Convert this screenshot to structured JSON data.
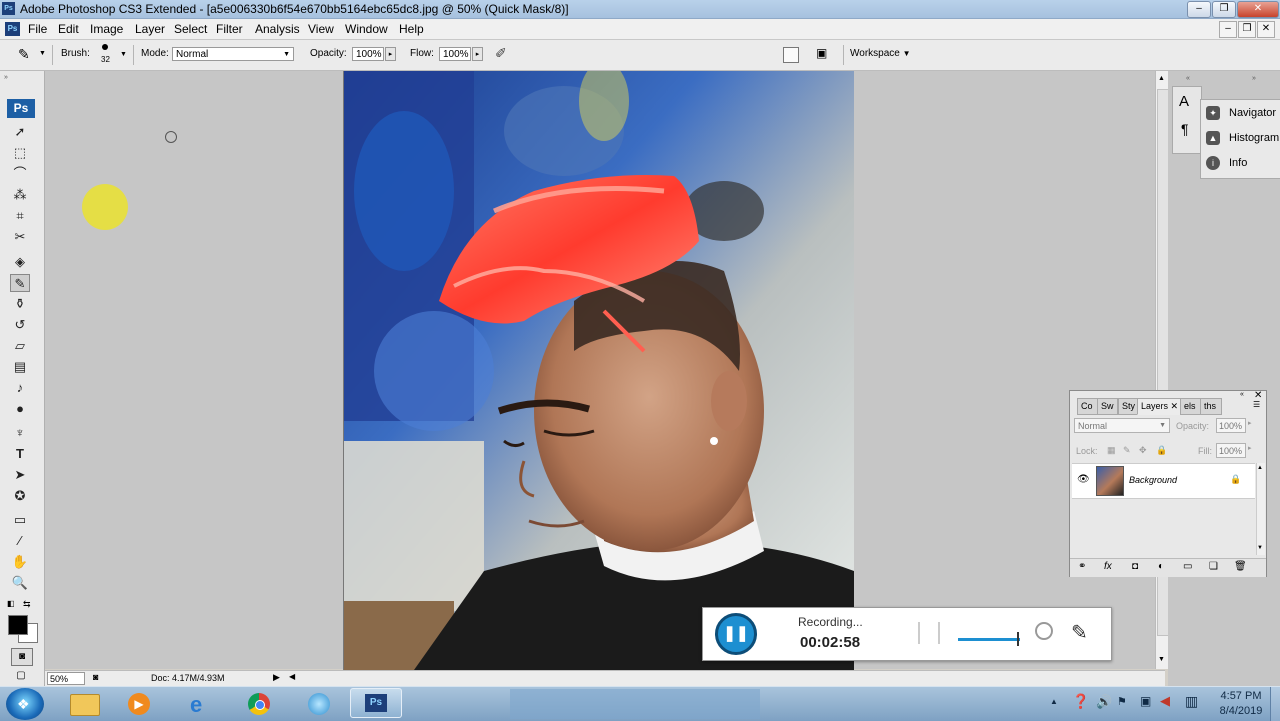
{
  "window": {
    "title": "Adobe Photoshop CS3 Extended - [a5e006330b6f54e670bb5164ebc65dc8.jpg @ 50% (Quick Mask/8)]"
  },
  "menu": [
    "File",
    "Edit",
    "Image",
    "Layer",
    "Select",
    "Filter",
    "Analysis",
    "View",
    "Window",
    "Help"
  ],
  "options": {
    "brush_label": "Brush:",
    "brush_size": "32",
    "mode_label": "Mode:",
    "mode_value": "Normal",
    "opacity_label": "Opacity:",
    "opacity_value": "100%",
    "flow_label": "Flow:",
    "flow_value": "100%",
    "workspace_label": "Workspace"
  },
  "toolbox": {
    "logo": "Ps",
    "tools": [
      "move-tool",
      "marquee-tool",
      "lasso-tool",
      "magic-wand-tool",
      "crop-tool",
      "slice-tool",
      "healing-brush-tool",
      "brush-tool",
      "clone-stamp-tool",
      "history-brush-tool",
      "eraser-tool",
      "gradient-tool",
      "blur-tool",
      "dodge-tool",
      "pen-tool",
      "type-tool",
      "path-selection-tool",
      "shape-tool",
      "notes-tool",
      "eyedropper-tool",
      "hand-tool",
      "zoom-tool"
    ]
  },
  "status": {
    "zoom": "50%",
    "doc": "Doc: 4.17M/4.93M"
  },
  "right_panels": {
    "icons": [
      "A",
      "¶"
    ],
    "items": [
      {
        "label": "Navigator",
        "icon": "navigator-icon"
      },
      {
        "label": "Histogram",
        "icon": "histogram-icon"
      },
      {
        "label": "Info",
        "icon": "info-icon"
      }
    ]
  },
  "layers_panel": {
    "tabs": [
      "Co",
      "Sw",
      "Sty",
      "Layers",
      "els",
      "ths"
    ],
    "blend_mode": "Normal",
    "opacity_label": "Opacity:",
    "opacity_value": "100%",
    "lock_label": "Lock:",
    "fill_label": "Fill:",
    "fill_value": "100%",
    "layers": [
      {
        "name": "Background",
        "visible": true,
        "locked": true
      }
    ]
  },
  "recording": {
    "status": "Recording...",
    "time": "00:02:58"
  },
  "taskbar": {
    "time": "4:57 PM",
    "date": "8/4/2019",
    "apps": [
      "windows-explorer",
      "media-player",
      "internet-explorer",
      "chrome",
      "network-app",
      "photoshop"
    ]
  },
  "colors": {
    "accent": "#1d8fd1",
    "hair": "#ff4a3a",
    "highlight": "#e7e03a"
  }
}
